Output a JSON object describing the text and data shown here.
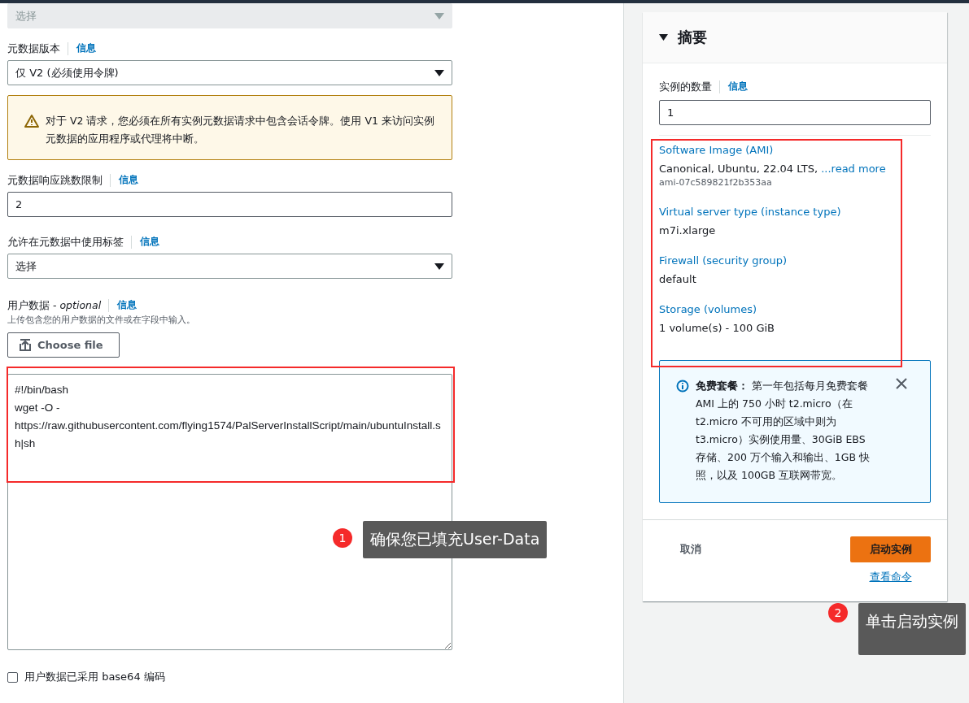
{
  "form": {
    "top_select": {
      "value": "选择",
      "disabled": true
    },
    "metadata_version": {
      "label": "元数据版本",
      "info": "信息",
      "value": "仅 V2 (必须使用令牌)"
    },
    "warning": {
      "text": "对于 V2 请求，您必须在所有实例元数据请求中包含会话令牌。使用 V1 来访问实例元数据的应用程序或代理将中断。"
    },
    "hop_limit": {
      "label": "元数据响应跳数限制",
      "info": "信息",
      "value": "2"
    },
    "allow_tags": {
      "label": "允许在元数据中使用标签",
      "info": "信息",
      "value": "选择"
    },
    "user_data": {
      "label": "用户数据 - *optional*",
      "info": "信息",
      "hint": "上传包含您的用户数据的文件或在字段中输入。",
      "choose_file": "Choose file",
      "value": "#!/bin/bash\nwget -O -\nhttps://raw.githubusercontent.com/flying1574/PalServerInstallScript/main/ubuntuInstall.sh|sh"
    },
    "base64": {
      "label": "用户数据已采用 base64 编码",
      "checked": false
    }
  },
  "summary": {
    "title": "摘要",
    "expanded": true,
    "instances": {
      "label": "实例的数量",
      "info": "信息",
      "value": "1"
    },
    "details": [
      {
        "title": "Software Image (AMI)",
        "value": "Canonical, Ubuntu, 22.04 LTS, ",
        "link": "...read more",
        "sub": "ami-07c589821f2b353aa"
      },
      {
        "title": "Virtual server type (instance type)",
        "value": "m7i.xlarge"
      },
      {
        "title": "Firewall (security group)",
        "value": "default"
      },
      {
        "title": "Storage (volumes)",
        "value": "1 volume(s) - 100 GiB"
      }
    ],
    "free_tier": {
      "title": "免费套餐：",
      "text": "第一年包括每月免费套餐 AMI 上的 750 小时 t2.micro（在 t2.micro 不可用的区域中则为 t3.micro）实例使用量、30GiB EBS 存储、200 万个输入和输出、1GB 快照，以及 100GB 互联网带宽。"
    },
    "cancel": "取消",
    "launch": "启动实例",
    "view_command": "查看命令"
  },
  "annotations": [
    {
      "number": "1",
      "text": "确保您已填充User-Data"
    },
    {
      "number": "2",
      "text": "单击启动实例"
    }
  ]
}
